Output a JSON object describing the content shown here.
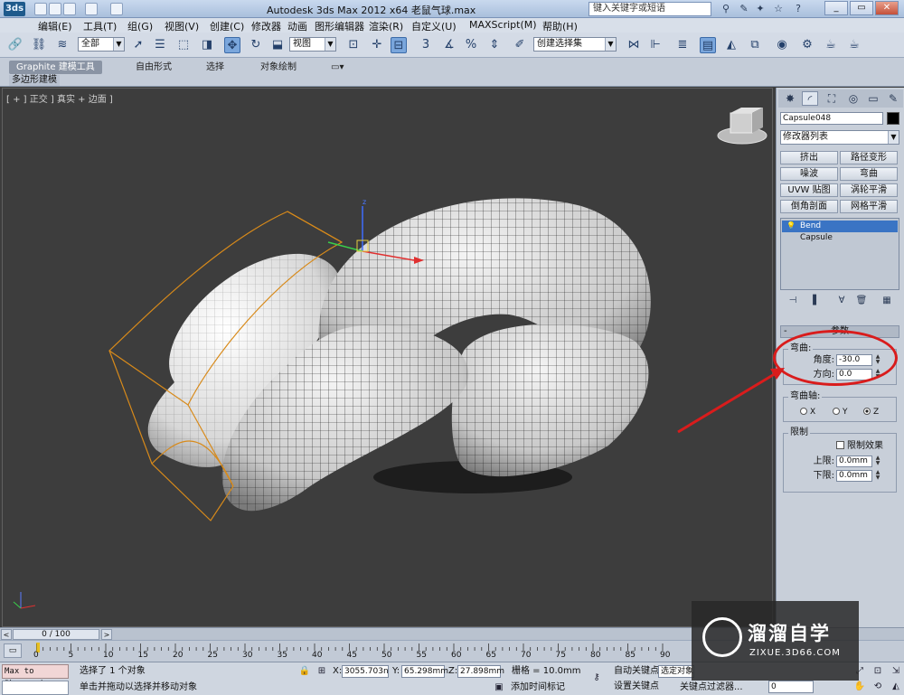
{
  "titlebar": {
    "logo": "3ds",
    "title": "Autodesk 3ds Max  2012 x64    老鼠气球.max",
    "search_placeholder": "键入关键字或短语",
    "window_buttons": [
      "_",
      "▭",
      "✕"
    ]
  },
  "menu": [
    "编辑(E)",
    "工具(T)",
    "组(G)",
    "视图(V)",
    "创建(C)",
    "修改器",
    "动画",
    "图形编辑器",
    "渲染(R)",
    "自定义(U)",
    "MAXScript(M)",
    "帮助(H)"
  ],
  "toolbar": {
    "selection_filter": "全部",
    "reference_coord": "视图",
    "named_selection": "创建选择集"
  },
  "ribbon": {
    "tabs": [
      "Graphite 建模工具",
      "自由形式",
      "选择",
      "对象绘制"
    ],
    "active_tab": "Graphite 建模工具",
    "sub_label": "多边形建模"
  },
  "viewport": {
    "label": "[ + ] 正交 ] 真实 + 边面 ]"
  },
  "command_panel": {
    "object_name": "Capsule048",
    "modifier_list": "修改器列表",
    "modifier_buttons": [
      "挤出",
      "路径变形",
      "噪波",
      "弯曲",
      "UVW 贴图",
      "涡轮平滑",
      "倒角剖面",
      "网格平滑"
    ],
    "stack": [
      "Bend",
      "Capsule"
    ],
    "rollout_title": "参数",
    "bend_group": "弯曲:",
    "angle_label": "角度:",
    "angle_value": "-30.0",
    "direction_label": "方向:",
    "direction_value": "0.0",
    "axis_group": "弯曲轴:",
    "axes": [
      "X",
      "Y",
      "Z"
    ],
    "selected_axis": "Z",
    "limit_group": "限制",
    "limit_effect": "限制效果",
    "upper_label": "上限:",
    "upper_value": "0.0mm",
    "lower_label": "下限:",
    "lower_value": "0.0mm"
  },
  "timeline": {
    "frame_display": "0 / 100",
    "ticks": [
      "0",
      "5",
      "10",
      "15",
      "20",
      "25",
      "30",
      "35",
      "40",
      "45",
      "50",
      "55",
      "60",
      "65",
      "70",
      "75",
      "80",
      "85",
      "90"
    ]
  },
  "status": {
    "maxscript": "Max to Physcs (",
    "selected": "选择了 1 个对象",
    "prompt": "单击并拖动以选择并移动对象",
    "x_label": "X:",
    "x_value": "3055.703n",
    "y_label": "Y:",
    "y_value": "65.298mm",
    "z_label": "Z:",
    "z_value": "27.898mm",
    "grid": "栅格 = 10.0mm",
    "add_time_tag": "添加时间标记",
    "auto_key": "自动关键点",
    "set_key": "设置关键点",
    "selected_object": "选定对象",
    "key_filters": "关键点过滤器...",
    "frame": "0"
  },
  "watermark": {
    "title": "溜溜自学",
    "url": "ZIXUE.3D66.COM"
  },
  "colors": {
    "annotation": "#d91c1c",
    "selection_box": "#d88a1a",
    "viewport_bg": "#3d3d3d"
  }
}
